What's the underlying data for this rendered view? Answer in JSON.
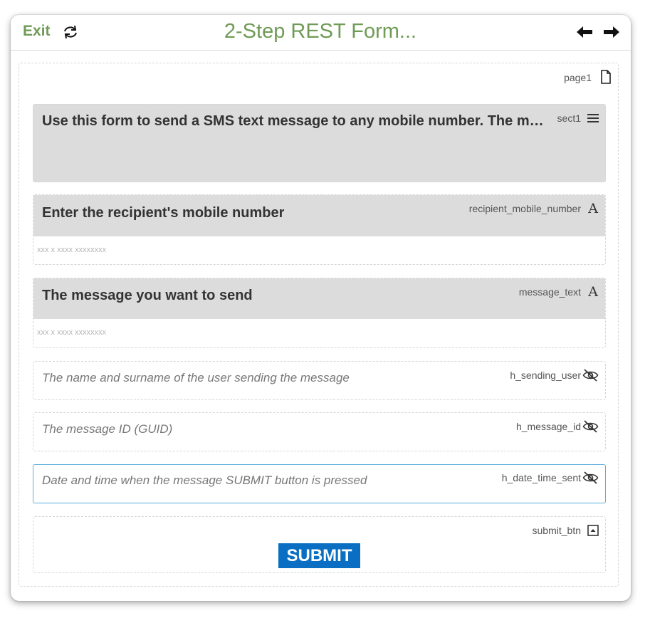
{
  "header": {
    "exit_label": "Exit",
    "title": "2-Step REST Form...",
    "refresh_icon": "refresh-icon",
    "prev_icon": "arrow-left-icon",
    "next_icon": "arrow-right-icon"
  },
  "page": {
    "label": "page1",
    "icon": "page-icon"
  },
  "section": {
    "tag": "sect1",
    "icon": "list-icon",
    "text": "Use this form to send a SMS text message to any mobile number. The message will be sent"
  },
  "fields": {
    "recipient": {
      "tag": "recipient_mobile_number",
      "label": "Enter the recipient's mobile number",
      "placeholder": "xxx x xxxx xxxxxxxx",
      "icon": "text-field-icon"
    },
    "message": {
      "tag": "message_text",
      "label": "The message you want to send",
      "placeholder": "xxx x xxxx xxxxxxxx",
      "icon": "text-field-icon"
    }
  },
  "hidden_fields": {
    "sending_user": {
      "tag": "h_sending_user",
      "text": "The name and surname of the user sending the message",
      "icon": "eye-off-icon"
    },
    "message_id": {
      "tag": "h_message_id",
      "text": "The message ID (GUID)",
      "icon": "eye-off-icon"
    },
    "date_time_sent": {
      "tag": "h_date_time_sent",
      "text": "Date and time when the message SUBMIT button is pressed",
      "icon": "eye-off-icon"
    }
  },
  "submit": {
    "tag": "submit_btn",
    "label": "SUBMIT",
    "icon": "button-icon"
  },
  "colors": {
    "accent_green": "#6f9b56",
    "submit_blue": "#0a6fc2",
    "active_border": "#5aaedc",
    "header_gray": "#dcdcdc"
  }
}
